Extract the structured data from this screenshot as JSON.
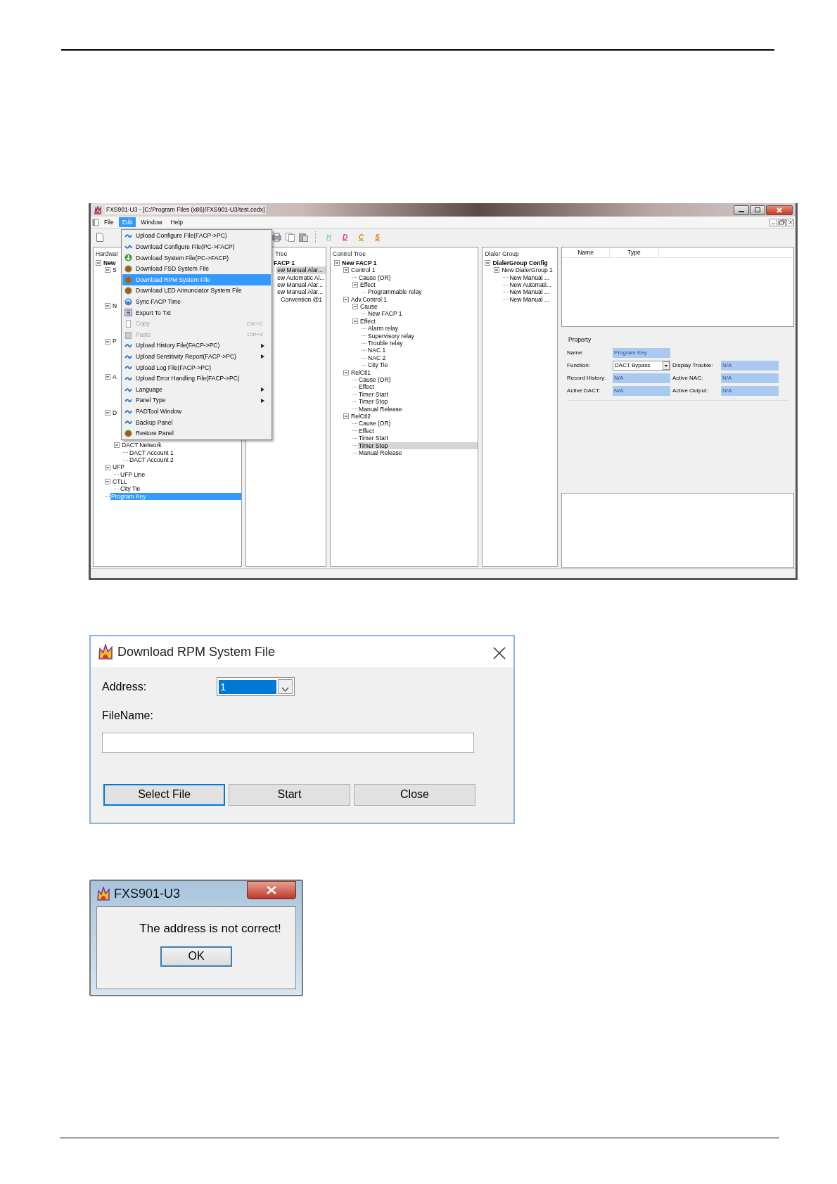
{
  "app": {
    "title": "FXS901-U3 - [C:/Program Files (x86)/FXS901-U3/test.cedx]",
    "menu": [
      {
        "label": "File",
        "selected": false
      },
      {
        "label": "Edit",
        "selected": true
      },
      {
        "label": "Window",
        "selected": false
      },
      {
        "label": "Help",
        "selected": false
      }
    ],
    "toolbar_letters": [
      {
        "label": "H",
        "color": "#8ccfc8"
      },
      {
        "label": "D",
        "color": "#e0409a"
      },
      {
        "label": "C",
        "color": "#b89800"
      },
      {
        "label": "S",
        "color": "#e8780a"
      }
    ],
    "edit_menu": [
      {
        "label": "Upload Configure File(FACP->PC)",
        "kind": "upload",
        "submenu": false,
        "disabled": false,
        "selected": false
      },
      {
        "label": "Download Configure File(PC->FACP)",
        "kind": "download",
        "submenu": false,
        "disabled": false,
        "selected": false
      },
      {
        "label": "Download System File(PC->FACP)",
        "kind": "green",
        "submenu": false,
        "disabled": false,
        "selected": false
      },
      {
        "label": "Download FSD System File",
        "kind": "red",
        "submenu": false,
        "disabled": false,
        "selected": false
      },
      {
        "label": "Download RPM System File",
        "kind": "red",
        "submenu": false,
        "disabled": false,
        "selected": true
      },
      {
        "label": "Download LED Annunciator System File",
        "kind": "red",
        "submenu": false,
        "disabled": false,
        "selected": false
      },
      {
        "label": "Sync FACP Time",
        "kind": "sync",
        "submenu": false,
        "disabled": false,
        "selected": false
      },
      {
        "label": "Export To Txt",
        "kind": "export",
        "submenu": false,
        "disabled": false,
        "selected": false
      },
      {
        "label": "Copy",
        "kind": "copy",
        "shortcut": "Ctrl+C",
        "submenu": false,
        "disabled": true,
        "selected": false
      },
      {
        "label": "Paste",
        "kind": "paste",
        "shortcut": "Ctrl+V",
        "submenu": false,
        "disabled": true,
        "selected": false
      },
      {
        "label": "Upload History File(FACP->PC)",
        "kind": "upload",
        "submenu": true,
        "disabled": false,
        "selected": false
      },
      {
        "label": "Upload Sensitivity Report(FACP->PC)",
        "kind": "upload",
        "submenu": true,
        "disabled": false,
        "selected": false
      },
      {
        "label": "Upload Log File(FACP->PC)",
        "kind": "upload",
        "submenu": false,
        "disabled": false,
        "selected": false
      },
      {
        "label": "Upload Error Handling File(FACP->PC)",
        "kind": "upload",
        "submenu": false,
        "disabled": false,
        "selected": false
      },
      {
        "label": "Language",
        "kind": "upload",
        "submenu": true,
        "disabled": false,
        "selected": false
      },
      {
        "label": "Panel Type",
        "kind": "upload",
        "submenu": true,
        "disabled": false,
        "selected": false
      },
      {
        "label": "PADTool Window",
        "kind": "upload",
        "submenu": false,
        "disabled": false,
        "selected": false
      },
      {
        "label": "Backup Panel",
        "kind": "upload",
        "submenu": false,
        "disabled": false,
        "selected": false
      },
      {
        "label": "Restore Panel",
        "kind": "red",
        "submenu": false,
        "disabled": false,
        "selected": false
      }
    ],
    "hardware_tree": {
      "header": "Hardwar",
      "nodes": [
        {
          "label": "New",
          "expanded": true,
          "selected": false,
          "children": [
            {
              "label": "S",
              "expanded": true,
              "covered": true,
              "selected": false
            },
            {
              "label": "N",
              "expanded": true,
              "covered": true,
              "selected": false
            },
            {
              "label": "P",
              "expanded": true,
              "covered": true,
              "selected": false
            },
            {
              "label": "A",
              "expanded": true,
              "covered": true,
              "selected": false
            },
            {
              "label": "D",
              "expanded": true,
              "covered": true,
              "selected": false,
              "children": [
                {
                  "label": "DACT Network",
                  "expanded": true,
                  "selected": false,
                  "children": [
                    {
                      "label": "DACT Account 1",
                      "selected": false
                    },
                    {
                      "label": "DACT Account 2",
                      "selected": false
                    }
                  ]
                }
              ]
            },
            {
              "label": "UFP",
              "expanded": true,
              "selected": false,
              "children": [
                {
                  "label": "UFP Line",
                  "selected": false
                }
              ]
            },
            {
              "label": "CTLL",
              "expanded": true,
              "selected": false,
              "children": [
                {
                  "label": "City Tie",
                  "selected": false
                }
              ]
            },
            {
              "label": "Program Key",
              "selected": true
            }
          ]
        }
      ]
    },
    "second_tree": {
      "header": "Tree",
      "nodes": [
        {
          "label": "FACP 1",
          "selected": false,
          "children": [
            {
              "label": "ew Manual Alar...",
              "selected": true
            },
            {
              "label": "ew Automatic Al...",
              "selected": false
            },
            {
              "label": "ew Manual Alar...",
              "selected": false
            },
            {
              "label": "ew Manual Alar...",
              "selected": false,
              "children": [
                {
                  "label": "Convention @1",
                  "selected": false
                }
              ]
            }
          ]
        }
      ]
    },
    "control_tree": {
      "header": "Control Tree",
      "nodes": [
        {
          "label": "New FACP 1",
          "expanded": true,
          "selected": false,
          "children": [
            {
              "label": "Control 1",
              "expanded": true,
              "selected": false,
              "children": [
                {
                  "label": "Cause (OR)",
                  "selected": false
                },
                {
                  "label": "Effect",
                  "expanded": true,
                  "selected": false,
                  "children": [
                    {
                      "label": "Programmable relay",
                      "selected": false
                    }
                  ]
                }
              ]
            },
            {
              "label": "Adv.Control 1",
              "expanded": true,
              "selected": false,
              "children": [
                {
                  "label": "Cause",
                  "expanded": true,
                  "selected": false,
                  "children": [
                    {
                      "label": "New FACP 1",
                      "selected": false
                    }
                  ]
                },
                {
                  "label": "Effect",
                  "expanded": true,
                  "selected": false,
                  "children": [
                    {
                      "label": "Alarm relay",
                      "selected": false
                    },
                    {
                      "label": "Supervisory relay",
                      "selected": false
                    },
                    {
                      "label": "Trouble relay",
                      "selected": false
                    },
                    {
                      "label": "NAC 1",
                      "selected": false
                    },
                    {
                      "label": "NAC 2",
                      "selected": false
                    },
                    {
                      "label": "City Tie",
                      "selected": false
                    }
                  ]
                }
              ]
            },
            {
              "label": "RelCtl1",
              "expanded": true,
              "selected": false,
              "children": [
                {
                  "label": "Cause (OR)",
                  "selected": false
                },
                {
                  "label": "Effect",
                  "selected": false
                },
                {
                  "label": "Timer Start",
                  "selected": false
                },
                {
                  "label": "Timer Stop",
                  "selected": false
                },
                {
                  "label": "Manual Release",
                  "selected": false
                }
              ]
            },
            {
              "label": "RelCtl2",
              "expanded": true,
              "selected": false,
              "children": [
                {
                  "label": "Cause (OR)",
                  "selected": false
                },
                {
                  "label": "Effect",
                  "selected": false
                },
                {
                  "label": "Timer Start",
                  "selected": false
                },
                {
                  "label": "Timer Stop",
                  "selected": true
                },
                {
                  "label": "Manual Release",
                  "selected": false
                }
              ]
            }
          ]
        }
      ]
    },
    "dialer_tree": {
      "header": "Dialer Group",
      "nodes": [
        {
          "label": "DialerGroup Config",
          "expanded": true,
          "selected": false,
          "children": [
            {
              "label": "New DialerGroup 1",
              "expanded": true,
              "selected": false,
              "children": [
                {
                  "label": "New Manual ...",
                  "selected": false
                },
                {
                  "label": "New Automati...",
                  "selected": false
                },
                {
                  "label": "New Manual ...",
                  "selected": false
                },
                {
                  "label": "New Manual ...",
                  "selected": false
                }
              ]
            }
          ]
        }
      ]
    },
    "table": {
      "columns": [
        "Name",
        "Type"
      ]
    },
    "property": {
      "title": "Property",
      "fields": [
        {
          "label": "Name:",
          "value": "Program Key",
          "kind": "text"
        },
        {
          "label": "Function:",
          "value": "DACT Bypass",
          "kind": "select"
        },
        {
          "label": "Display Trouble:",
          "value": "N/A",
          "kind": "text"
        },
        {
          "label": "Record History:",
          "value": "N/A",
          "kind": "text"
        },
        {
          "label": "Active NAC:",
          "value": "N/A",
          "kind": "text"
        },
        {
          "label": "Active DACT:",
          "value": "N/A",
          "kind": "text"
        },
        {
          "label": "Active Output:",
          "value": "N/A",
          "kind": "text"
        }
      ]
    }
  },
  "download_dialog": {
    "title": "Download RPM System File",
    "address_label": "Address:",
    "address_value": "1",
    "filename_label": "FileName:",
    "buttons": [
      {
        "label": "Select File",
        "default": true
      },
      {
        "label": "Start",
        "default": false
      },
      {
        "label": "Close",
        "default": false
      }
    ]
  },
  "alert_dialog": {
    "title": "FXS901-U3",
    "message": "The address is not correct!",
    "buttons": [
      {
        "label": "OK",
        "default": true
      }
    ]
  }
}
